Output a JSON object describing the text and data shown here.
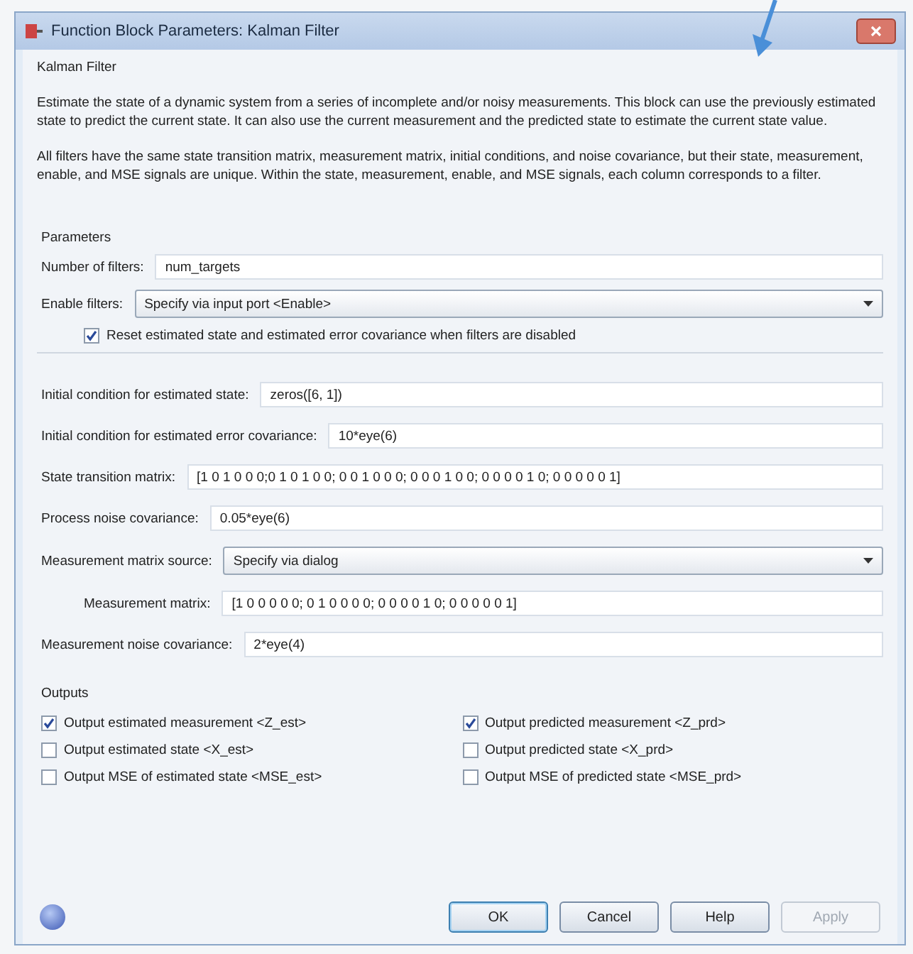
{
  "window": {
    "title": "Function Block Parameters: Kalman Filter"
  },
  "block_name": "Kalman Filter",
  "description": [
    "Estimate the state of a dynamic system from a series of incomplete and/or noisy measurements. This block can use the previously estimated state to predict the current state. It can also use the current measurement and the predicted state to estimate the current state value.",
    "All filters have the same state transition matrix, measurement matrix, initial conditions, and noise covariance, but their state, measurement, enable, and MSE signals are unique. Within the state, measurement, enable, and MSE signals, each column corresponds to a filter."
  ],
  "parameters": {
    "heading": "Parameters",
    "top_fields": [
      {
        "kind": "text",
        "label": "Number of filters:",
        "value": "num_targets",
        "indented": false
      },
      {
        "kind": "dropdown",
        "label": "Enable filters:",
        "value": "Specify via input port <Enable>",
        "indented": false
      },
      {
        "kind": "checkbox",
        "label": "Reset estimated state and estimated error covariance when filters are disabled",
        "checked": true
      }
    ],
    "fields": [
      {
        "kind": "text",
        "label": "Initial condition for estimated state:",
        "value": "zeros([6, 1])",
        "indented": false
      },
      {
        "kind": "text",
        "label": "Initial condition for estimated error covariance:",
        "value": "10*eye(6)",
        "indented": false
      },
      {
        "kind": "text",
        "label": "State transition matrix:",
        "value": "[1 0 1 0 0 0;0 1 0 1 0 0; 0 0 1 0 0 0; 0 0 0 1 0 0; 0 0 0 0 1 0; 0 0 0 0 0 1]",
        "indented": false
      },
      {
        "kind": "text",
        "label": "Process noise covariance:",
        "value": "0.05*eye(6)",
        "indented": false
      },
      {
        "kind": "dropdown",
        "label": "Measurement matrix source:",
        "value": "Specify via dialog",
        "indented": false
      },
      {
        "kind": "text",
        "label": "Measurement matrix:",
        "value": "[1 0 0 0 0 0; 0 1 0 0 0 0; 0 0 0 0 1 0; 0 0 0 0 0 1]",
        "indented": true
      },
      {
        "kind": "text",
        "label": "Measurement noise covariance:",
        "value": "2*eye(4)",
        "indented": false
      }
    ]
  },
  "outputs": {
    "heading": "Outputs",
    "options": [
      {
        "label": "Output estimated measurement <Z_est>",
        "checked": true
      },
      {
        "label": "Output predicted measurement <Z_prd>",
        "checked": true
      },
      {
        "label": "Output estimated state <X_est>",
        "checked": false
      },
      {
        "label": "Output predicted state <X_prd>",
        "checked": false
      },
      {
        "label": "Output MSE of estimated state <MSE_est>",
        "checked": false
      },
      {
        "label": "Output MSE of predicted state <MSE_prd>",
        "checked": false
      }
    ]
  },
  "buttons": [
    {
      "label": "OK",
      "default": true,
      "disabled": false
    },
    {
      "label": "Cancel",
      "default": false,
      "disabled": false
    },
    {
      "label": "Help",
      "default": false,
      "disabled": false
    },
    {
      "label": "Apply",
      "default": false,
      "disabled": true
    }
  ]
}
